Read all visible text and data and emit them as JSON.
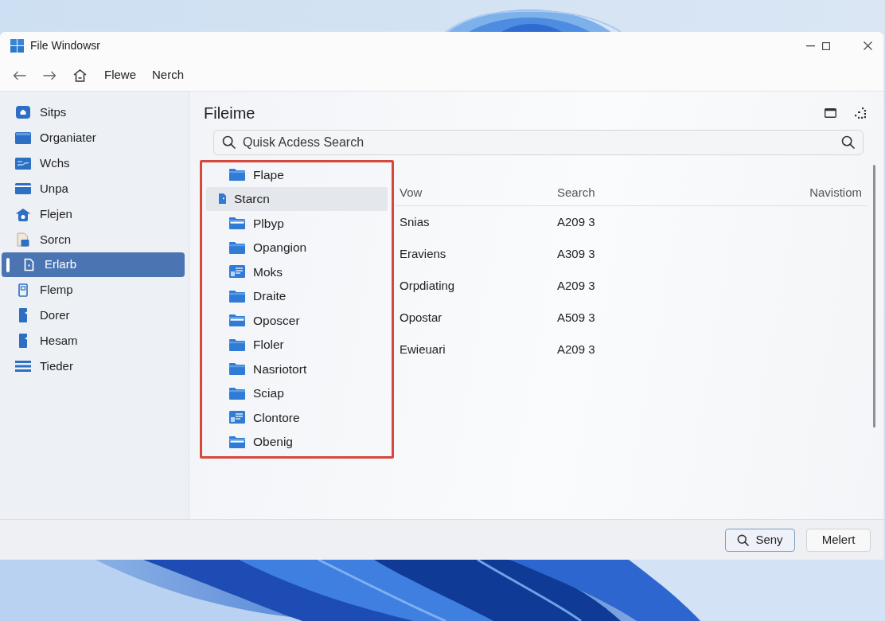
{
  "window": {
    "title": "File Windowsr"
  },
  "toolbar": {
    "items": [
      "Flewe",
      "Nerch"
    ]
  },
  "sidebar": {
    "items": [
      {
        "label": "Sitps",
        "kind": "home-tile",
        "selected": false
      },
      {
        "label": "Organiater",
        "kind": "folder",
        "selected": false
      },
      {
        "label": "Wchs",
        "kind": "pictures",
        "selected": false
      },
      {
        "label": "Unpa",
        "kind": "card",
        "selected": false
      },
      {
        "label": "Flejen",
        "kind": "house",
        "selected": false
      },
      {
        "label": "Sorcn",
        "kind": "document-image",
        "selected": false
      },
      {
        "label": "Erlarb",
        "kind": "file-outline",
        "selected": true
      },
      {
        "label": "Flemp",
        "kind": "document",
        "selected": false
      },
      {
        "label": "Dorer",
        "kind": "file",
        "selected": false
      },
      {
        "label": "Hesam",
        "kind": "file",
        "selected": false
      },
      {
        "label": "Tieder",
        "kind": "lines",
        "selected": false
      }
    ]
  },
  "content": {
    "title": "Fileime",
    "search": {
      "placeholder": "Quisk Acdess Search"
    },
    "folder_tree": {
      "highlighted": true,
      "items": [
        {
          "label": "Flape",
          "kind": "folder",
          "selected": false
        },
        {
          "label": "Starcn",
          "kind": "file",
          "selected": true
        },
        {
          "label": "Plbyp",
          "kind": "folder-striped",
          "selected": false
        },
        {
          "label": "Opangion",
          "kind": "folder",
          "selected": false
        },
        {
          "label": "Moks",
          "kind": "shortcut",
          "selected": false
        },
        {
          "label": "Draite",
          "kind": "folder",
          "selected": false
        },
        {
          "label": "Oposcer",
          "kind": "folder-striped",
          "selected": false
        },
        {
          "label": "Floler",
          "kind": "folder",
          "selected": false
        },
        {
          "label": "Nasriotort",
          "kind": "folder",
          "selected": false
        },
        {
          "label": "Sciap",
          "kind": "folder",
          "selected": false
        },
        {
          "label": "Clontore",
          "kind": "shortcut",
          "selected": false
        },
        {
          "label": "Obenig",
          "kind": "folder-striped",
          "selected": false
        }
      ]
    },
    "table": {
      "columns": [
        "Vow",
        "Search",
        "Navistiom"
      ],
      "rows": [
        [
          "Snias",
          "A209 3"
        ],
        [
          "Eraviens",
          "A309 3"
        ],
        [
          "Orpdiating",
          "A209 3"
        ],
        [
          "Opostar",
          "A509 3"
        ],
        [
          "Ewieuari",
          "A209 3"
        ]
      ]
    }
  },
  "footer": {
    "buttons": [
      {
        "label": "Seny",
        "kind": "search",
        "focused": true
      },
      {
        "label": "Melert",
        "kind": "plain",
        "focused": false
      }
    ]
  }
}
